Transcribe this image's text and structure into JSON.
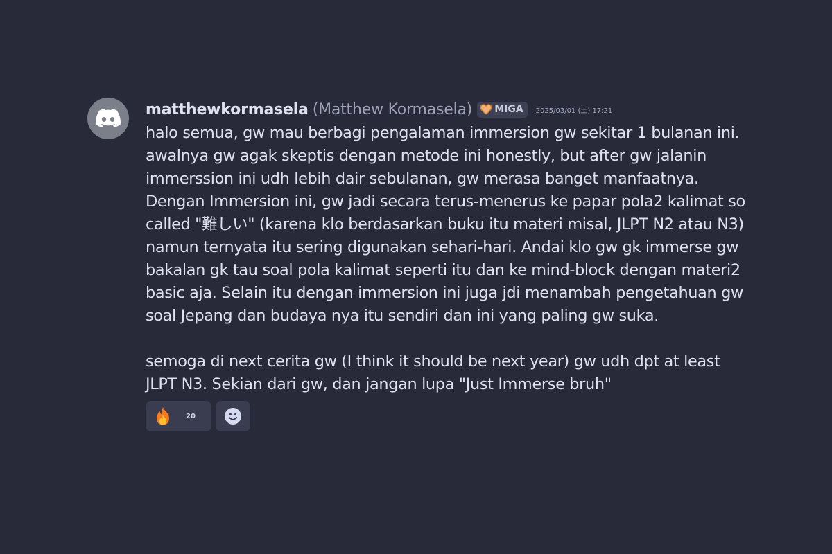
{
  "message": {
    "avatar_icon": "discord-logo-icon",
    "username": "matthewkormasela",
    "display_name": "(Matthew Kormasela)",
    "tag": {
      "icon": "orange-heart-icon",
      "label": "MIGA"
    },
    "timestamp": "2025/03/01 (土) 17:21",
    "paragraphs": [
      "halo semua, gw mau berbagi pengalaman immersion gw sekitar 1 bulanan ini. awalnya gw agak skeptis dengan metode ini honestly, but after gw jalanin immerssion ini udh lebih dair sebulanan, gw merasa banget manfaatnya. Dengan Immersion ini, gw jadi secara terus-menerus ke papar pola2 kalimat so called \"難しい\"  (karena klo berdasarkan buku itu materi misal, JLPT N2 atau N3) namun ternyata itu sering digunakan sehari-hari. Andai klo gw gk immerse gw bakalan gk tau soal pola kalimat seperti itu dan ke mind-block dengan materi2 basic aja. Selain itu dengan immersion ini juga jdi menambah pengetahuan gw soal Jepang dan budaya nya itu sendiri dan ini yang paling gw suka.",
      "semoga di next cerita gw (I think it should be next year)  gw udh dpt at least JLPT N3. Sekian dari gw,  dan jangan lupa \"Just Immerse bruh\""
    ],
    "reactions": [
      {
        "icon": "fire-icon",
        "count": "20"
      }
    ],
    "add_reaction_icon": "smiley-add-reaction-icon"
  },
  "colors": {
    "background": "#282a3a",
    "text": "#dfe1ee",
    "muted": "#9ea2b6",
    "chip": "#3a3d4f",
    "avatar": "#7b7f8a"
  }
}
